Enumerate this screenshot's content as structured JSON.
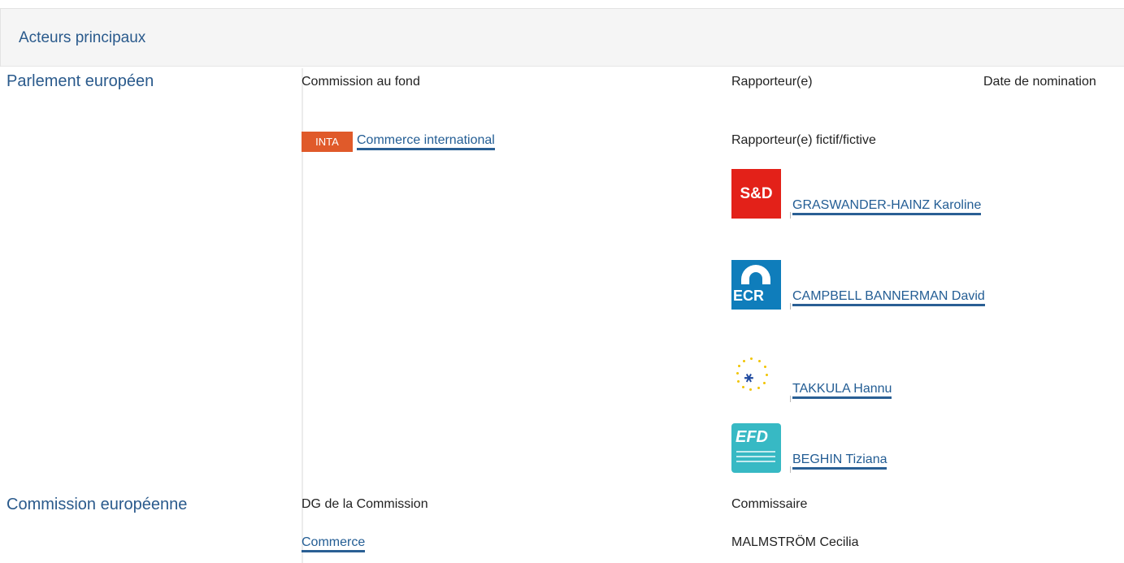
{
  "header": {
    "title": "Acteurs principaux"
  },
  "parliament": {
    "label": "Parlement européen",
    "col_committee": "Commission au fond",
    "col_rapporteur": "Rapporteur(e)",
    "col_date": "Date de nomination",
    "committee_code": "INTA",
    "committee_name": "Commerce international",
    "shadow_label": "Rapporteur(e) fictif/fictive",
    "shadows": [
      {
        "group": "S&D",
        "name": "GRASWANDER-HAINZ Karoline",
        "logo_icon": "sd-group-logo-icon",
        "color": "#e32119"
      },
      {
        "group": "ECR",
        "name": "CAMPBELL BANNERMAN David",
        "logo_icon": "ecr-group-logo-icon",
        "color": "#0f7dbb"
      },
      {
        "group": "",
        "name": "TAKKULA Hannu",
        "logo_icon": "alde-group-logo-icon",
        "color": "#1f4aa0"
      },
      {
        "group": "EFD",
        "name": "BEGHIN Tiziana",
        "logo_icon": "efdd-group-logo-icon",
        "color": "#37b9c4"
      }
    ]
  },
  "commission": {
    "label": "Commission européenne",
    "col_dg": "DG de la Commission",
    "col_commissioner": "Commissaire",
    "dg_name": "Commerce",
    "commissioner_name": "MALMSTRÖM Cecilia"
  },
  "colors": {
    "accent": "#2a5a8c",
    "link": "#235d94",
    "inta_badge": "#e05a2a"
  }
}
